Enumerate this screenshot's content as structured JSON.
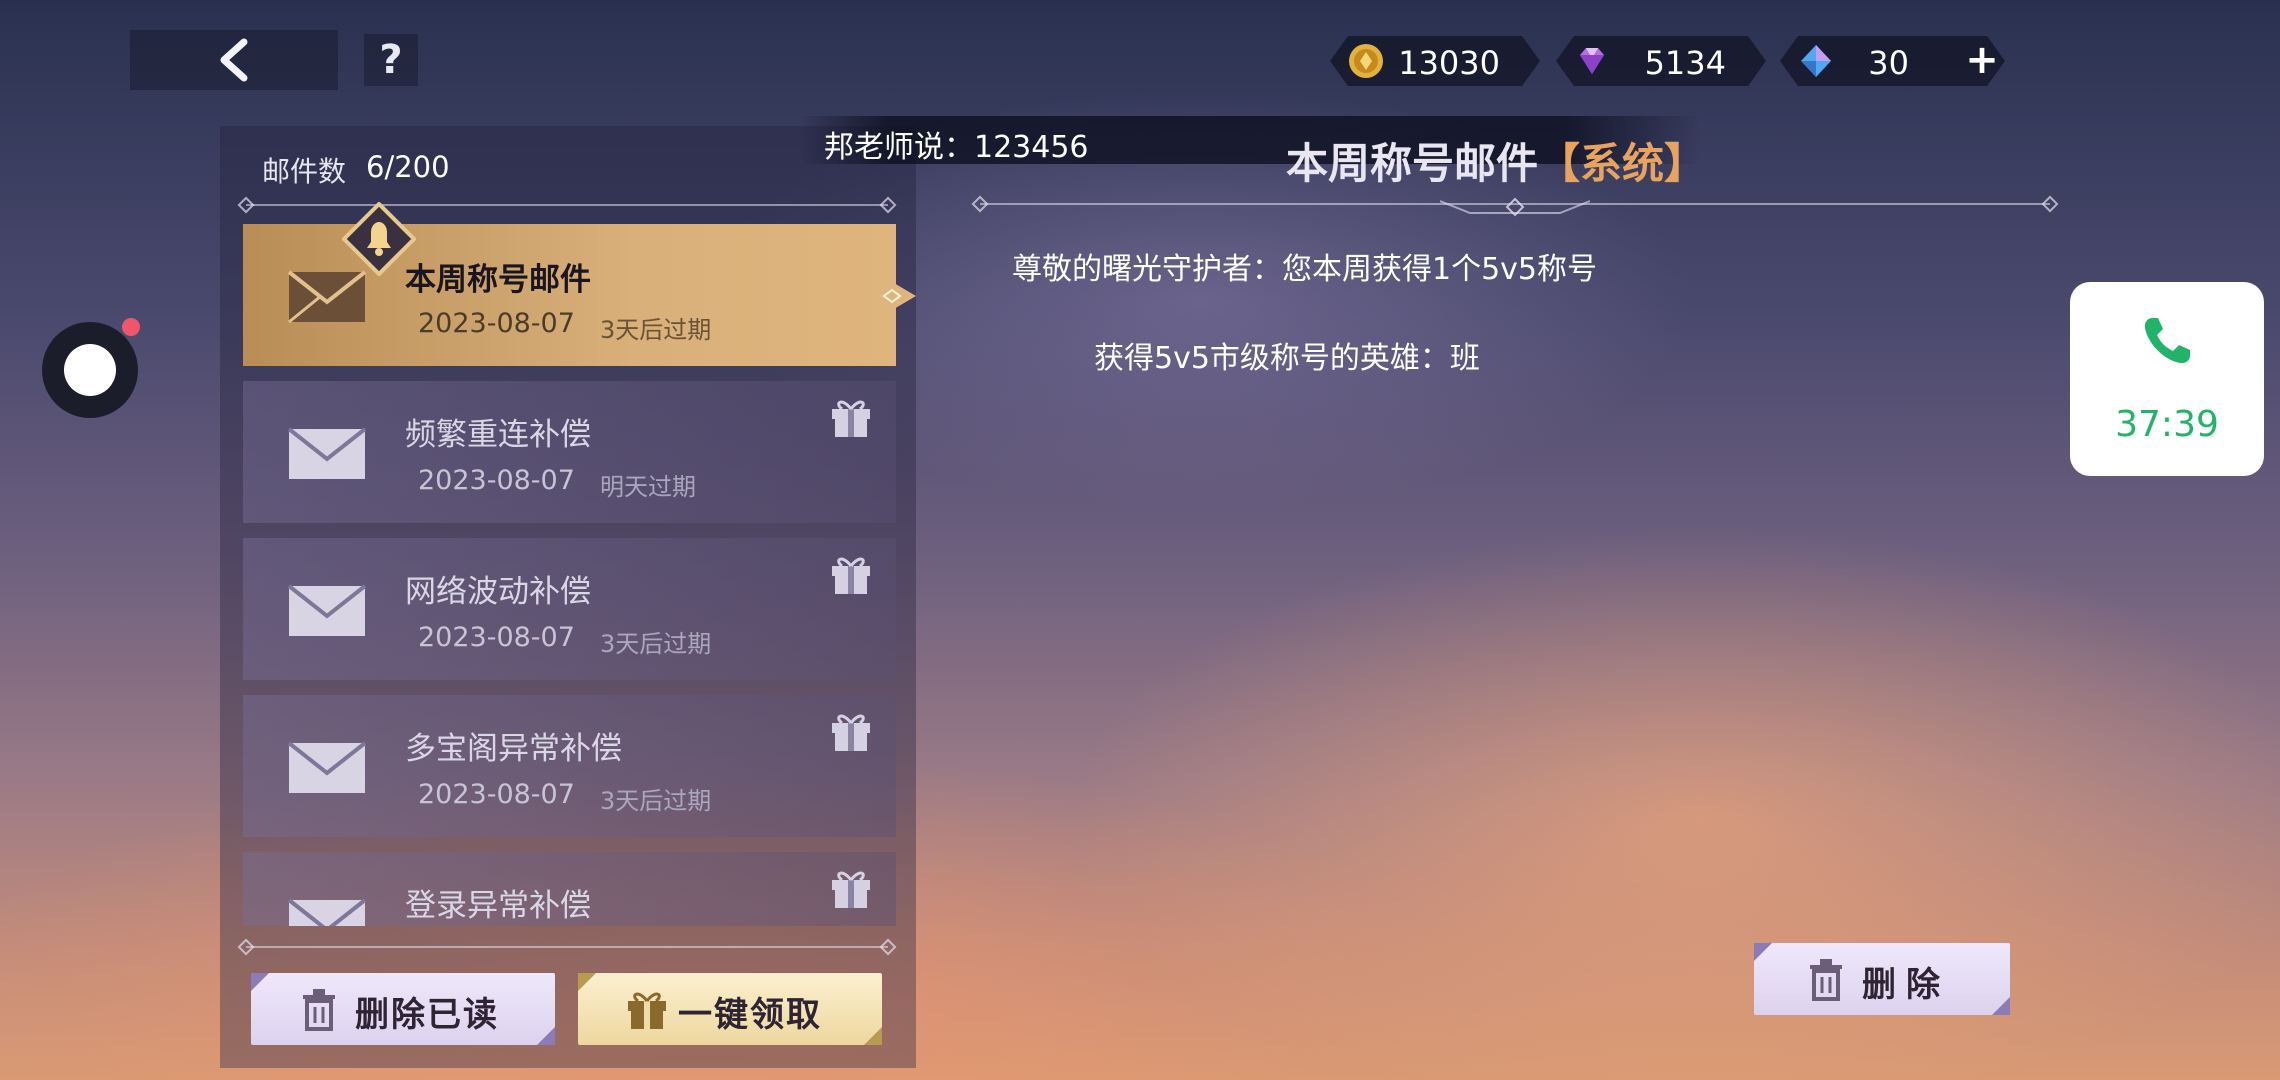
{
  "header": {
    "help_label": "?"
  },
  "currencies": [
    {
      "name": "coin",
      "value": "13030",
      "color": "#e3b23c"
    },
    {
      "name": "diamond",
      "value": "5134",
      "color": "#b46ee8"
    },
    {
      "name": "crystal",
      "value": "30",
      "color": "#4fa8f0"
    }
  ],
  "plus_label": "+",
  "broadcast": "邦老师说：123456",
  "mailbox": {
    "count_label": "邮件数",
    "count_value": "6/200",
    "items": [
      {
        "title": "本周称号邮件",
        "date": "2023-08-07",
        "expire": "3天后过期",
        "active": true,
        "has_gift": false
      },
      {
        "title": "频繁重连补偿",
        "date": "2023-08-07",
        "expire": "明天过期",
        "active": false,
        "has_gift": true
      },
      {
        "title": "网络波动补偿",
        "date": "2023-08-07",
        "expire": "3天后过期",
        "active": false,
        "has_gift": true
      },
      {
        "title": "多宝阁异常补偿",
        "date": "2023-08-07",
        "expire": "3天后过期",
        "active": false,
        "has_gift": true
      },
      {
        "title": "登录异常补偿",
        "date": "",
        "expire": "",
        "active": false,
        "has_gift": true
      }
    ],
    "delete_read_label": "删除已读",
    "claim_all_label": "一键领取"
  },
  "detail": {
    "title": "本周称号邮件",
    "tag": "【系统】",
    "greeting": "尊敬的曙光守护者：您本周获得1个5v5称号",
    "body": "获得5v5市级称号的英雄：班",
    "delete_label": "删除"
  },
  "call": {
    "time": "37:39",
    "accent": "#22b36a"
  }
}
